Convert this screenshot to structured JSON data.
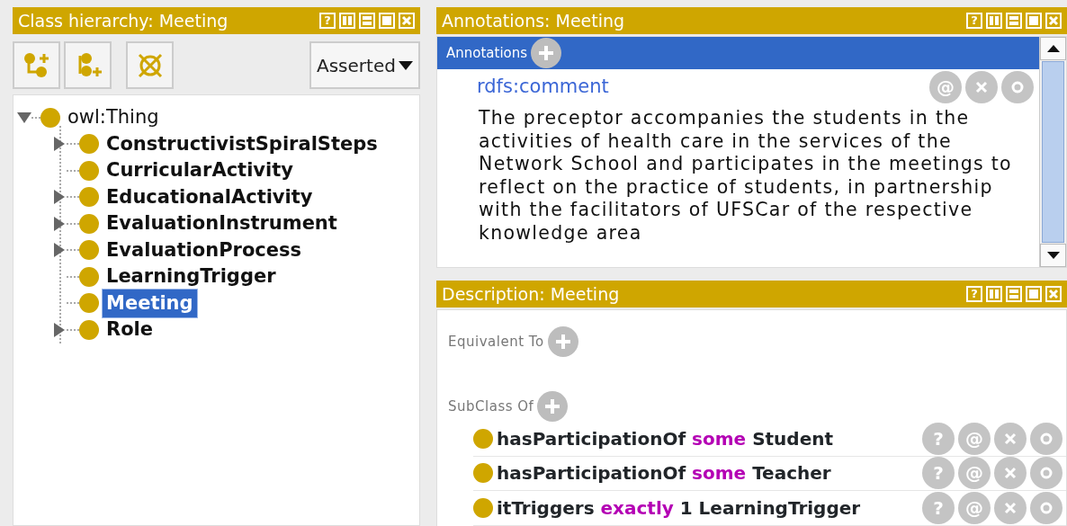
{
  "class_hierarchy": {
    "title": "Class hierarchy: Meeting",
    "help_label": "?",
    "mode_select": {
      "value": "Asserted"
    },
    "tree": [
      {
        "label": "owl:Thing",
        "expanded": true,
        "selected": false,
        "children": [
          {
            "label": "ConstructivistSpiralSteps",
            "expanded": false,
            "selected": false
          },
          {
            "label": "CurricularActivity",
            "selected": false
          },
          {
            "label": "EducationalActivity",
            "expanded": false,
            "selected": false
          },
          {
            "label": "EvaluationInstrument",
            "expanded": false,
            "selected": false
          },
          {
            "label": "EvaluationProcess",
            "expanded": false,
            "selected": false
          },
          {
            "label": "LearningTrigger",
            "selected": false
          },
          {
            "label": "Meeting",
            "selected": true
          },
          {
            "label": "Role",
            "expanded": false,
            "selected": false
          }
        ]
      }
    ]
  },
  "annotations_panel": {
    "title": "Annotations: Meeting",
    "help_label": "?",
    "header": "Annotations",
    "annotations": [
      {
        "property": "rdfs:comment",
        "value": "The preceptor accompanies the students in the activities of health care in the services of the Network School and participates in the meetings to reflect on the practice of students, in partnership with the facilitators of UFSCar of the respective knowledge area",
        "buttons": [
          "@"
        ]
      }
    ]
  },
  "description_panel": {
    "title": "Description: Meeting",
    "help_label": "?",
    "sections": [
      {
        "label": "Equivalent To"
      },
      {
        "label": "SubClass Of",
        "items": [
          {
            "parts": [
              {
                "text": "hasParticipationOf",
                "kind": "name"
              },
              {
                "text": "some",
                "kind": "keyword"
              },
              {
                "text": "Student",
                "kind": "name"
              }
            ],
            "buttons": [
              "?",
              "@"
            ]
          },
          {
            "parts": [
              {
                "text": "hasParticipationOf",
                "kind": "name"
              },
              {
                "text": "some",
                "kind": "keyword"
              },
              {
                "text": "Teacher",
                "kind": "name"
              }
            ],
            "buttons": [
              "?",
              "@"
            ]
          },
          {
            "parts": [
              {
                "text": "itTriggers",
                "kind": "name"
              },
              {
                "text": "exactly",
                "kind": "keyword"
              },
              {
                "text": "1 LearningTrigger",
                "kind": "name"
              }
            ],
            "buttons": [
              "?",
              "@"
            ]
          }
        ]
      }
    ]
  }
}
